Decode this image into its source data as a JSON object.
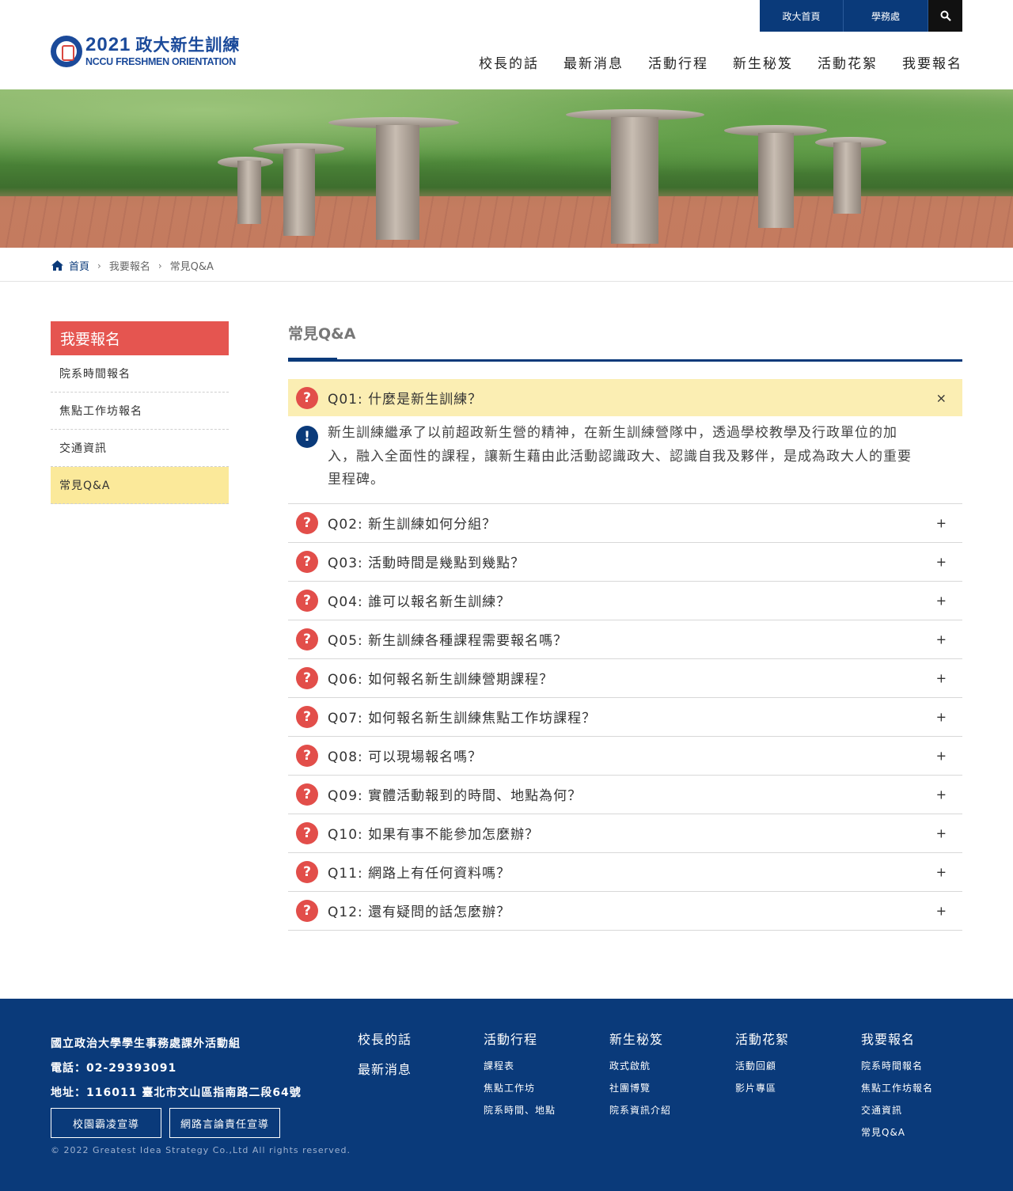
{
  "topbar": {
    "link1": "政大首頁",
    "link2": "學務處",
    "search_icon": "search-icon"
  },
  "logo": {
    "year": "2021",
    "title": "政大新生訓練",
    "subtitle": "NCCU FRESHMEN ORIENTATION"
  },
  "nav": [
    "校長的話",
    "最新消息",
    "活動行程",
    "新生秘笈",
    "活動花絮",
    "我要報名"
  ],
  "breadcrumb": {
    "home": "首頁",
    "level2": "我要報名",
    "current": "常見Q&A"
  },
  "sidebar": {
    "title": "我要報名",
    "items": [
      "院系時間報名",
      "焦點工作坊報名",
      "交通資訊",
      "常見Q&A"
    ],
    "active_index": 3
  },
  "content": {
    "title": "常見Q&A",
    "faq": [
      {
        "q": "Q01: 什麼是新生訓練？",
        "open": true,
        "toggle": "×",
        "a": "新生訓練繼承了以前超政新生營的精神，在新生訓練營隊中，透過學校教學及行政單位的加入，融入全面性的課程，讓新生藉由此活動認識政大、認識自我及夥伴，是成為政大人的重要里程碑。"
      },
      {
        "q": "Q02: 新生訓練如何分組？",
        "toggle": "+"
      },
      {
        "q": "Q03: 活動時間是幾點到幾點？",
        "toggle": "+"
      },
      {
        "q": "Q04: 誰可以報名新生訓練？",
        "toggle": "+"
      },
      {
        "q": "Q05: 新生訓練各種課程需要報名嗎？",
        "toggle": "+"
      },
      {
        "q": "Q06: 如何報名新生訓練營期課程？",
        "toggle": "+"
      },
      {
        "q": "Q07: 如何報名新生訓練焦點工作坊課程？",
        "toggle": "+"
      },
      {
        "q": "Q08: 可以現場報名嗎？",
        "toggle": "+"
      },
      {
        "q": "Q09: 實體活動報到的時間、地點為何？",
        "toggle": "+"
      },
      {
        "q": "Q10: 如果有事不能參加怎麼辦？",
        "toggle": "+"
      },
      {
        "q": "Q11: 網路上有任何資料嗎？",
        "toggle": "+"
      },
      {
        "q": "Q12: 還有疑問的話怎麼辦？",
        "toggle": "+"
      }
    ],
    "q_icon": "?",
    "a_icon": "!"
  },
  "footer": {
    "org": "國立政治大學學生事務處課外活動組",
    "tel": "電話：02-29393091",
    "addr": "地址：116011 臺北市文山區指南路二段64號",
    "btn1": "校園霸凌宣導",
    "btn2": "網路言論責任宣導",
    "copyright": "© 2022 Greatest Idea Strategy Co.,Ltd All rights reserved.",
    "cols": [
      {
        "heads": [
          "校長的話",
          "最新消息"
        ],
        "links": []
      },
      {
        "heads": [
          "活動行程"
        ],
        "links": [
          "課程表",
          "焦點工作坊",
          "院系時間、地點"
        ]
      },
      {
        "heads": [
          "新生秘笈"
        ],
        "links": [
          "政式啟航",
          "社團博覽",
          "院系資訊介紹"
        ]
      },
      {
        "heads": [
          "活動花絮"
        ],
        "links": [
          "活動回顧",
          "影片專區"
        ]
      },
      {
        "heads": [
          "我要報名"
        ],
        "links": [
          "院系時間報名",
          "焦點工作坊報名",
          "交通資訊",
          "常見Q&A"
        ]
      }
    ]
  },
  "colors": {
    "navy": "#0a3a7a",
    "red": "#e55550",
    "highlight": "#fbe99a"
  }
}
